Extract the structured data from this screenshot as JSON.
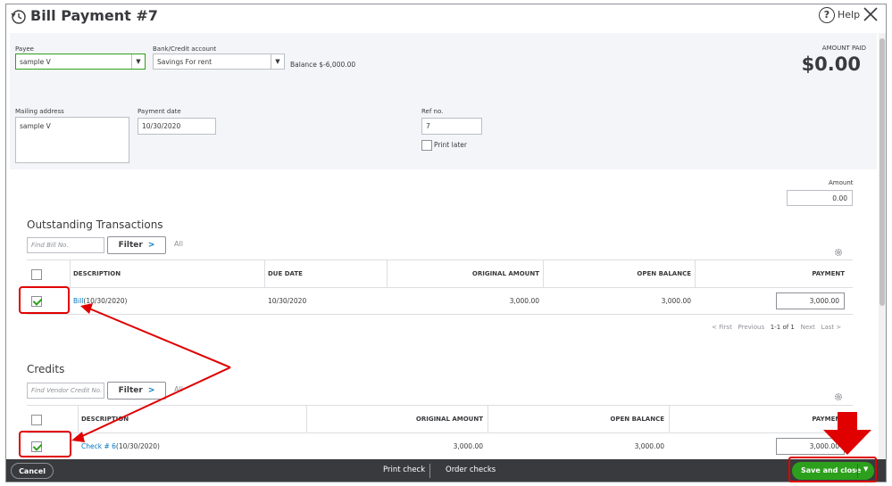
{
  "window": {
    "title": "Bill Payment #7",
    "help_label": "Help"
  },
  "header": {
    "payee_label": "Payee",
    "payee_value": "sample V",
    "bank_label": "Bank/Credit account",
    "bank_value": "Savings For rent",
    "balance_text": "Balance $-6,000.00",
    "amount_paid_label": "AMOUNT PAID",
    "amount_paid_value": "$0.00",
    "mailing_label": "Mailing address",
    "mailing_value": "sample V",
    "payment_date_label": "Payment date",
    "payment_date_value": "10/30/2020",
    "ref_label": "Ref no.",
    "ref_value": "7",
    "print_later_label": "Print later"
  },
  "amount": {
    "label": "Amount",
    "value": "0.00"
  },
  "outstanding": {
    "title": "Outstanding Transactions",
    "search_placeholder": "Find Bill No.",
    "filter_label": "Filter",
    "all_label": "All",
    "columns": [
      "DESCRIPTION",
      "DUE DATE",
      "ORIGINAL AMOUNT",
      "OPEN BALANCE",
      "PAYMENT"
    ],
    "rows": [
      {
        "checked": true,
        "desc_link": "Bill",
        "desc_rest": " (10/30/2020)",
        "due_date": "10/30/2020",
        "original": "3,000.00",
        "open_balance": "3,000.00",
        "payment": "3,000.00"
      }
    ],
    "pager": {
      "first": "< First",
      "previous": "Previous",
      "range": "1-1 of 1",
      "next": "Next",
      "last": "Last >"
    }
  },
  "credits": {
    "title": "Credits",
    "search_placeholder": "Find Vendor Credit No.",
    "filter_label": "Filter",
    "all_label": "All",
    "columns": [
      "DESCRIPTION",
      "ORIGINAL AMOUNT",
      "OPEN BALANCE",
      "PAYMENT"
    ],
    "rows": [
      {
        "checked": true,
        "desc_link": "Check # 6",
        "desc_rest": " (10/30/2020)",
        "original": "3,000.00",
        "open_balance": "3,000.00",
        "payment": "3,000.00"
      }
    ]
  },
  "footer": {
    "cancel_label": "Cancel",
    "print_check_label": "Print check",
    "order_checks_label": "Order checks",
    "save_label": "Save and close"
  },
  "colors": {
    "accent_green": "#2ca01c",
    "link_blue": "#0077c5",
    "footer_bg": "#393a3d",
    "annotation_red": "#e00000"
  },
  "icons": [
    "history-icon",
    "help-icon",
    "close-icon",
    "gear-icon",
    "chevron-right-icon",
    "dropdown-arrow-icon",
    "checkbox-icon"
  ]
}
